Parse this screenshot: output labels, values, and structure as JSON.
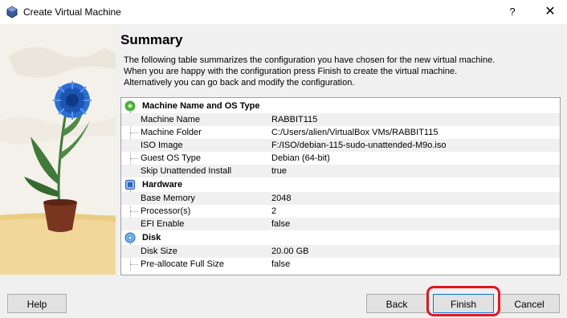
{
  "window": {
    "title": "Create Virtual Machine",
    "help_glyph": "?",
    "close_glyph": "✕"
  },
  "summary": {
    "title": "Summary",
    "description": [
      "The following table summarizes the configuration you have chosen for the new virtual machine.",
      "When you are happy with the configuration press Finish to create the virtual machine.",
      "Alternatively you can go back and modify the configuration."
    ]
  },
  "groups": [
    {
      "label": "Machine Name and OS Type",
      "icon": "os-type-icon",
      "rows": [
        {
          "key": "Machine Name",
          "value": "RABBIT115"
        },
        {
          "key": "Machine Folder",
          "value": "C:/Users/alien/VirtualBox VMs/RABBIT115"
        },
        {
          "key": "ISO Image",
          "value": "F:/ISO/debian-115-sudo-unattended-M9o.iso"
        },
        {
          "key": "Guest OS Type",
          "value": "Debian (64-bit)"
        },
        {
          "key": "Skip Unattended Install",
          "value": "true"
        }
      ]
    },
    {
      "label": "Hardware",
      "icon": "chip-icon",
      "rows": [
        {
          "key": "Base Memory",
          "value": "2048"
        },
        {
          "key": "Processor(s)",
          "value": "2"
        },
        {
          "key": "EFI Enable",
          "value": "false"
        }
      ]
    },
    {
      "label": "Disk",
      "icon": "disk-icon",
      "rows": [
        {
          "key": "Disk Size",
          "value": "20.00 GB"
        },
        {
          "key": "Pre-allocate Full Size",
          "value": "false"
        }
      ]
    }
  ],
  "buttons": {
    "help": "Help",
    "back": "Back",
    "finish": "Finish",
    "cancel": "Cancel"
  },
  "colors": {
    "highlight": "#e8141b",
    "flower": "#2a6fd6",
    "leaf": "#3f7a3a",
    "pot": "#7a3520",
    "sand": "#f1d89a"
  }
}
